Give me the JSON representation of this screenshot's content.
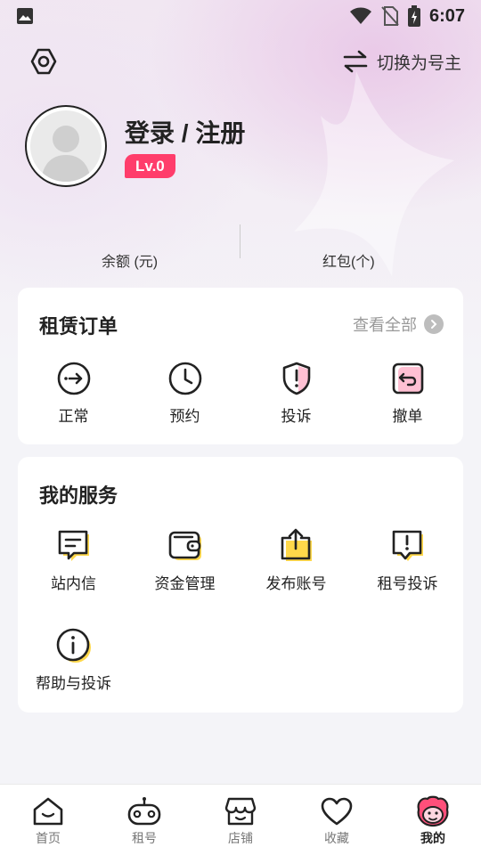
{
  "status_bar": {
    "time": "6:07"
  },
  "header": {
    "switch_label": "切换为号主"
  },
  "profile": {
    "title": "登录 / 注册",
    "level": "Lv.0"
  },
  "balances": {
    "balance_label": "余额 (元)",
    "redpacket_label": "红包(个)"
  },
  "orders": {
    "title": "租赁订单",
    "view_all": "查看全部",
    "items": [
      {
        "label": "正常",
        "icon": "arrow-circle-icon"
      },
      {
        "label": "预约",
        "icon": "clock-icon"
      },
      {
        "label": "投诉",
        "icon": "shield-alert-icon"
      },
      {
        "label": "撤单",
        "icon": "undo-icon"
      }
    ]
  },
  "services": {
    "title": "我的服务",
    "items": [
      {
        "label": "站内信",
        "icon": "message-icon"
      },
      {
        "label": "资金管理",
        "icon": "wallet-icon"
      },
      {
        "label": "发布账号",
        "icon": "upload-icon"
      },
      {
        "label": "租号投诉",
        "icon": "alert-message-icon"
      },
      {
        "label": "帮助与投诉",
        "icon": "info-icon"
      }
    ]
  },
  "bottom_nav": [
    {
      "label": "首页",
      "icon": "home-icon"
    },
    {
      "label": "租号",
      "icon": "gamepad-icon"
    },
    {
      "label": "店铺",
      "icon": "store-icon"
    },
    {
      "label": "收藏",
      "icon": "heart-icon"
    },
    {
      "label": "我的",
      "icon": "mascot-icon",
      "active": true
    }
  ],
  "colors": {
    "accent": "#ffd84a",
    "badge": "#ff3d6b",
    "pink": "#ff8fb3"
  }
}
